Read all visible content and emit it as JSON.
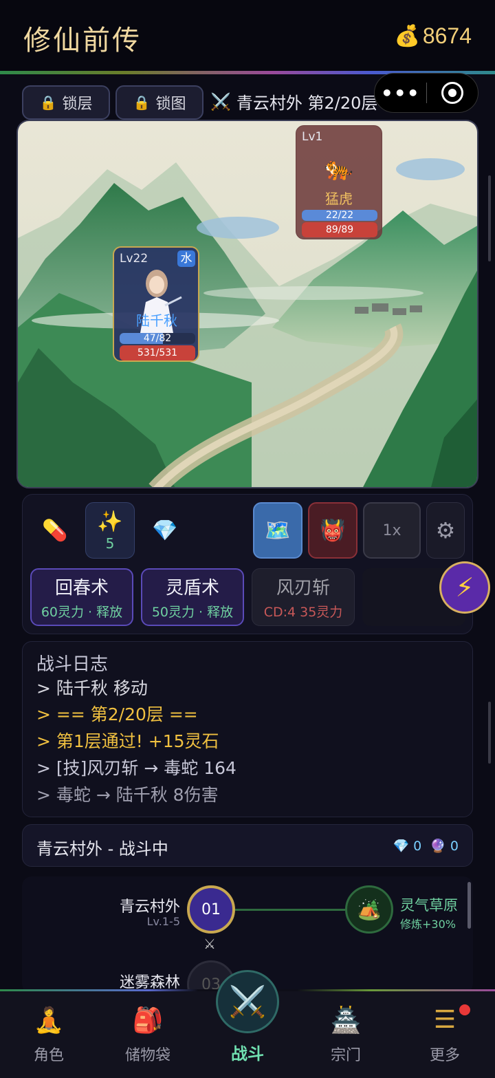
{
  "header": {
    "title": "修仙前传",
    "coin_icon": "money-bag-icon",
    "coins": "8674"
  },
  "controls": {
    "lock_floor": "锁层",
    "lock_map": "锁图",
    "stage": "青云村外 第2/20层"
  },
  "hero": {
    "level": "Lv22",
    "element": "水",
    "name": "陆千秋",
    "mp": "47/82",
    "mp_fraction": 0.57,
    "hp": "531/531",
    "hp_fraction": 1.0
  },
  "enemy": {
    "level": "Lv1",
    "name": "猛虎",
    "mp": "22/22",
    "mp_fraction": 1.0,
    "hp": "89/89",
    "hp_fraction": 1.0
  },
  "items": {
    "sparkle_count": "5"
  },
  "speed": {
    "label": "1x"
  },
  "skills": [
    {
      "name": "回春术",
      "cost": "60灵力 · 释放",
      "state": "ready"
    },
    {
      "name": "灵盾术",
      "cost": "50灵力 · 释放",
      "state": "ready"
    },
    {
      "name": "风刃斩",
      "cost": "CD:4  35灵力",
      "state": "cooldown"
    }
  ],
  "log": {
    "title": "战斗日志",
    "lines": [
      {
        "text": "> 陆千秋 移动",
        "color": "#d8d8e0"
      },
      {
        "text": "> == 第2/20层 ==",
        "color": "#f0c040"
      },
      {
        "text": "> 第1层通过! +15灵石",
        "color": "#f0c040"
      },
      {
        "text": "> [技]风刃斩 → 毒蛇 164",
        "color": "#c8c8d8"
      },
      {
        "text": "> 毒蛇 → 陆千秋 8伤害",
        "color": "#a0a0b0"
      }
    ]
  },
  "status": {
    "text": "青云村外 - 战斗中",
    "gems": "0",
    "orbs": "0"
  },
  "map": {
    "areas": [
      {
        "name": "青云村外",
        "range": "Lv.1-5",
        "node": "01"
      },
      {
        "name": "迷雾森林",
        "node": "03"
      }
    ],
    "rest": {
      "name": "灵气草原",
      "bonus": "修炼+30%"
    }
  },
  "nav": {
    "items": [
      {
        "label": "角色",
        "icon": "meditation-icon"
      },
      {
        "label": "储物袋",
        "icon": "bag-icon"
      },
      {
        "label": "战斗",
        "icon": "crossed-swords-icon"
      },
      {
        "label": "宗门",
        "icon": "temple-icon"
      },
      {
        "label": "更多",
        "icon": "menu-icon"
      }
    ]
  },
  "colors": {
    "accent": "#c9a850",
    "gold": "#f2cf7a",
    "green": "#6fd0a0",
    "panel": "#121222"
  }
}
